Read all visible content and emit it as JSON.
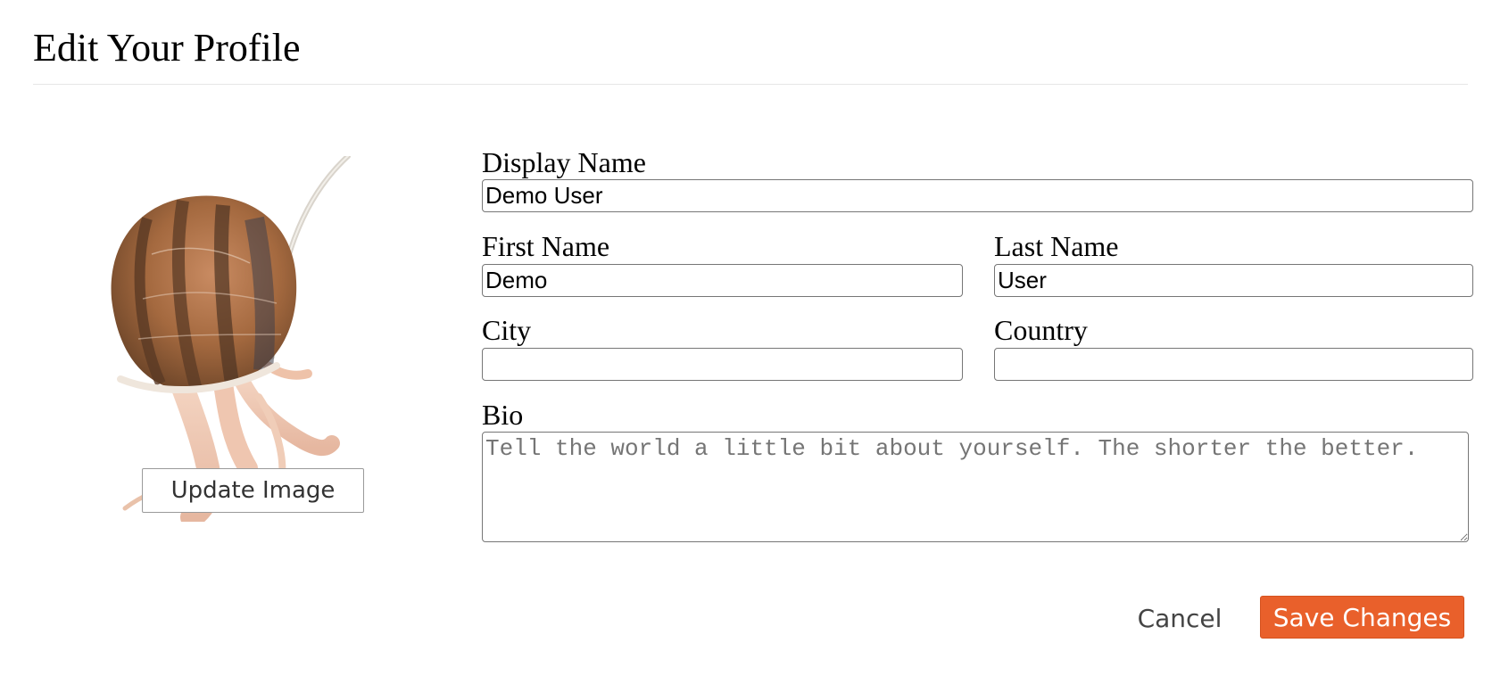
{
  "page": {
    "title": "Edit Your Profile"
  },
  "avatar": {
    "icon": "snail-photo",
    "update_label": "Update Image"
  },
  "form": {
    "display_name": {
      "label": "Display Name",
      "value": "Demo User",
      "placeholder": ""
    },
    "first_name": {
      "label": "First Name",
      "value": "Demo",
      "placeholder": ""
    },
    "last_name": {
      "label": "Last Name",
      "value": "User",
      "placeholder": ""
    },
    "city": {
      "label": "City",
      "value": "",
      "placeholder": ""
    },
    "country": {
      "label": "Country",
      "value": "",
      "placeholder": ""
    },
    "bio": {
      "label": "Bio",
      "value": "",
      "placeholder": "Tell the world a little bit about yourself. The shorter the better."
    }
  },
  "actions": {
    "cancel_label": "Cancel",
    "save_label": "Save Changes"
  },
  "colors": {
    "accent": "#e9602b",
    "divider": "#e6e6e6",
    "input_border": "#767676"
  }
}
